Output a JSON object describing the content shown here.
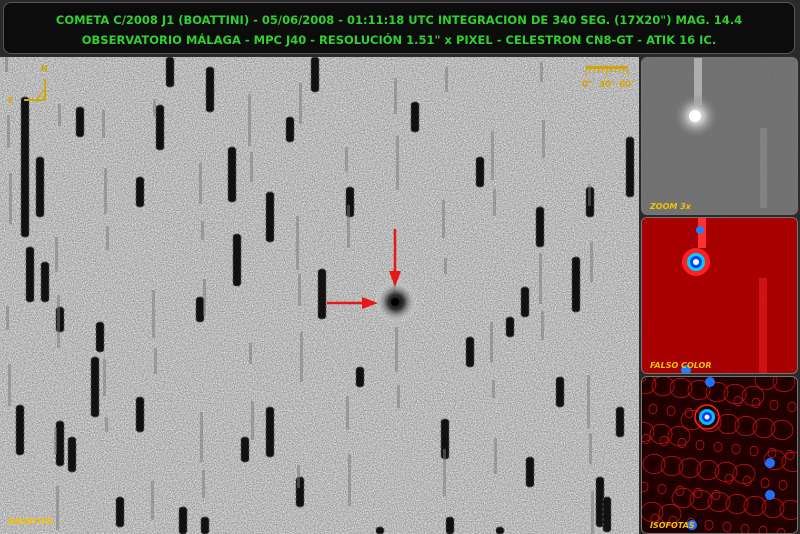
{
  "header": {
    "line1": "COMETA C/2008 J1 (BOATTINI) - 05/06/2008 - 01:11:18 UTC  INTEGRACION DE 340 SEG. (17X20\") MAG. 14.4",
    "line2": "OBSERVATORIO MÁLAGA  - MPC J40 - RESOLUCIÓN 1.51\" x PIXEL - CELESTRON CN8-GT - ATIK 16 IC."
  },
  "main_image": {
    "label": "NEGATIVO",
    "compass": {
      "north": "N",
      "east": "E"
    },
    "scale": {
      "ticks": [
        "0\"",
        "30\"",
        "60\""
      ]
    },
    "arrow_color": "#e81818"
  },
  "panels": [
    {
      "label": "ZOOM 3x"
    },
    {
      "label": "FALSO COLOR"
    },
    {
      "label": "ISOFOTAS"
    }
  ],
  "colors": {
    "title_green": "#2fd12f",
    "label_yellow": "#f3c200"
  }
}
